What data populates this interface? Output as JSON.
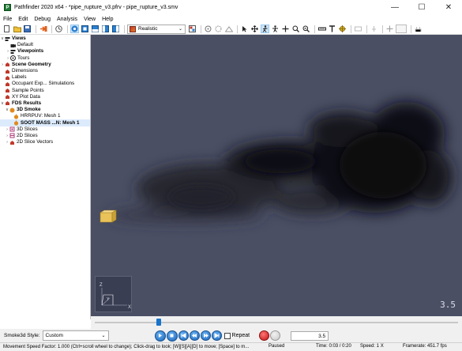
{
  "window": {
    "title": "Pathfinder 2020 x64 - *pipe_rupture_v3.pfrv - pipe_rupture_v3.smv",
    "app_icon_letter": "P",
    "minimize": "—",
    "maximize": "☐",
    "close": "✕"
  },
  "menu": [
    "File",
    "Edit",
    "Debug",
    "Analysis",
    "View",
    "Help"
  ],
  "toolbar": {
    "render_mode": "Realistic"
  },
  "tree": [
    {
      "label": "Views",
      "bold": true,
      "toggle": "∨",
      "icon": "views-icon",
      "depth": 0
    },
    {
      "label": "Default",
      "bold": false,
      "toggle": "",
      "icon": "camera-icon",
      "depth": 1
    },
    {
      "label": "Viewpoints",
      "bold": true,
      "toggle": "›",
      "icon": "viewpoints-icon",
      "depth": 1
    },
    {
      "label": "Tours",
      "bold": false,
      "toggle": "›",
      "icon": "tours-icon",
      "depth": 1
    },
    {
      "label": "Scene Geometry",
      "bold": true,
      "toggle": "›",
      "icon": "geometry-icon",
      "depth": 0
    },
    {
      "label": "Dimensions",
      "bold": false,
      "toggle": "",
      "icon": "dimensions-icon",
      "depth": 0
    },
    {
      "label": "Labels",
      "bold": false,
      "toggle": "",
      "icon": "labels-icon",
      "depth": 0
    },
    {
      "label": "Occupant Exp... Simulations",
      "bold": false,
      "toggle": "",
      "icon": "simulations-icon",
      "depth": 0
    },
    {
      "label": "Sample Points",
      "bold": false,
      "toggle": "",
      "icon": "sample-points-icon",
      "depth": 0
    },
    {
      "label": "XY Plot Data",
      "bold": false,
      "toggle": "",
      "icon": "plot-data-icon",
      "depth": 0
    },
    {
      "label": "FDS Results",
      "bold": true,
      "toggle": "∨",
      "icon": "fds-results-icon",
      "depth": 0
    },
    {
      "label": "3D Smoke",
      "bold": true,
      "toggle": "∨",
      "icon": "smoke-icon",
      "depth": 1
    },
    {
      "label": "HRRPUV: Mesh 1",
      "bold": false,
      "toggle": "",
      "icon": "hrrpuv-icon",
      "depth": 2
    },
    {
      "label": "SOOT MASS ...N: Mesh 1",
      "bold": true,
      "toggle": "",
      "icon": "soot-icon",
      "depth": 2,
      "selected": true
    },
    {
      "label": "3D Slices",
      "bold": false,
      "toggle": "›",
      "icon": "slices-3d-icon",
      "depth": 1
    },
    {
      "label": "2D Slices",
      "bold": false,
      "toggle": "›",
      "icon": "slices-2d-icon",
      "depth": 1
    },
    {
      "label": "2D Slice Vectors",
      "bold": false,
      "toggle": "›",
      "icon": "slice-vectors-icon",
      "depth": 1
    }
  ],
  "viewport": {
    "time_overlay": "3.5",
    "axis_z": "Z",
    "axis_y": "Y",
    "axis_x": "X"
  },
  "timeline": {
    "position_fraction": 0.175
  },
  "controls": {
    "style_label": "Smoke3d Style:",
    "style_value": "Custom",
    "repeat_label": "Repeat",
    "frame_value": "3.5"
  },
  "status": {
    "message": "Movement Speed Factor: 1.000 (Ctrl+scroll wheel to change); Click-drag to look; [W][S][A][D] to move; [Space] to m...",
    "paused": "Paused",
    "time": "Time: 0:03 / 0:20",
    "speed": "Speed: 1 X",
    "framerate": "Framerate: 451.7 fps"
  },
  "colors": {
    "viewport_bg": "#4a4f64",
    "smoke": "#111118",
    "selection": "#dcebfc",
    "accent": "#1a73c9"
  }
}
